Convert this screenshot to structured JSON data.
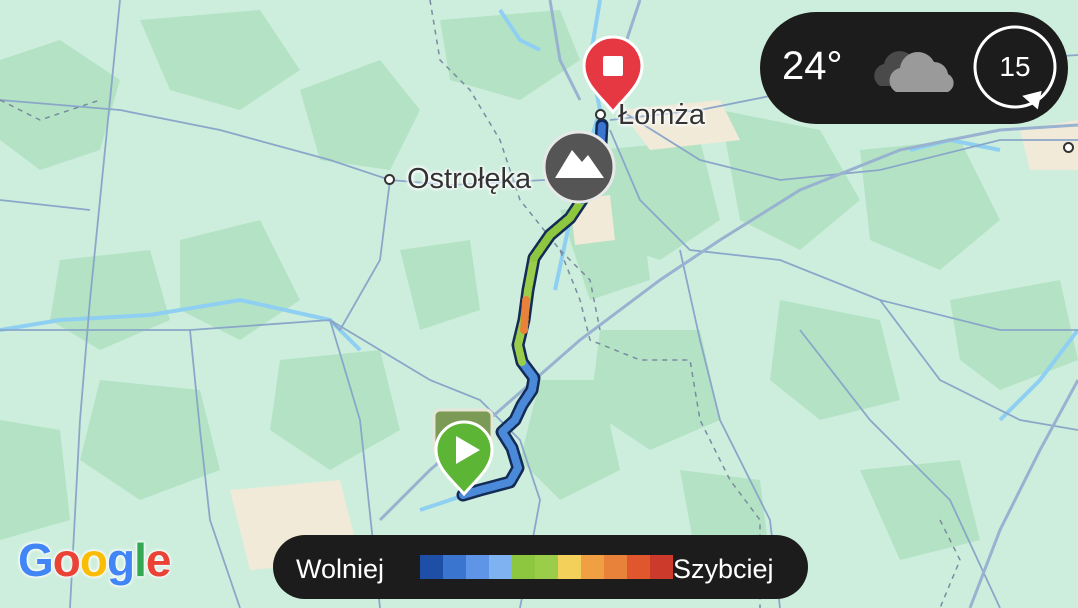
{
  "map": {
    "cities": [
      {
        "name": "Ostrołęka"
      },
      {
        "name": "Łomża"
      }
    ],
    "markers": {
      "start": {
        "icon": "play-icon",
        "color": "#5db535"
      },
      "end": {
        "icon": "stop-icon",
        "color": "#e53842"
      },
      "summit": {
        "icon": "mountain-icon",
        "color": "#555555"
      }
    },
    "attribution": {
      "letters": [
        "G",
        "o",
        "o",
        "g",
        "l",
        "e"
      ],
      "colors": [
        "#4285F4",
        "#EA4335",
        "#FBBC05",
        "#4285F4",
        "#34A853",
        "#EA4335"
      ]
    }
  },
  "weather": {
    "temperature": "24°",
    "condition_icon": "cloud-icon",
    "wind_speed": "15",
    "wind_icon": "wind-direction-icon"
  },
  "legend": {
    "slow_label": "Wolniej",
    "fast_label": "Szybciej",
    "colors": [
      "#1d4fa6",
      "#3a75cf",
      "#5e95e6",
      "#7fb2f0",
      "#8dc63f",
      "#9acd4a",
      "#f2d05a",
      "#f0a042",
      "#e8823a",
      "#e0572e",
      "#cc3a2c"
    ]
  }
}
